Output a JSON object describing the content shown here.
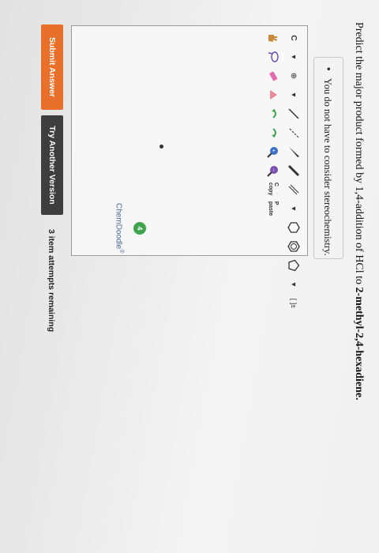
{
  "question": {
    "prefix": "Predict the major product formed by 1,4-addition of HCl to ",
    "compound": "2-methyl-2,4-hexadiene."
  },
  "instructions": {
    "bullet": "•",
    "text": "You do not have to consider stereochemistry."
  },
  "editor": {
    "watermark": "ChemDoodle",
    "watermark_mark": "®",
    "toolbar_top": [
      "C",
      "⊕",
      "⎚",
      "⎚"
    ],
    "toolbar_labels": {
      "element": "C",
      "copy": "C copy",
      "paste": "P paste",
      "bracket": "[ ]±",
      "charge": "⊕"
    },
    "badge_count": "4"
  },
  "actions": {
    "submit_label": "Submit Answer",
    "try_label": "Try Another Version",
    "attempts_text": "3 item attempts remaining"
  },
  "colors": {
    "submit": "#e8702a",
    "try": "#3e3e3e",
    "badge": "#3fa34d"
  }
}
